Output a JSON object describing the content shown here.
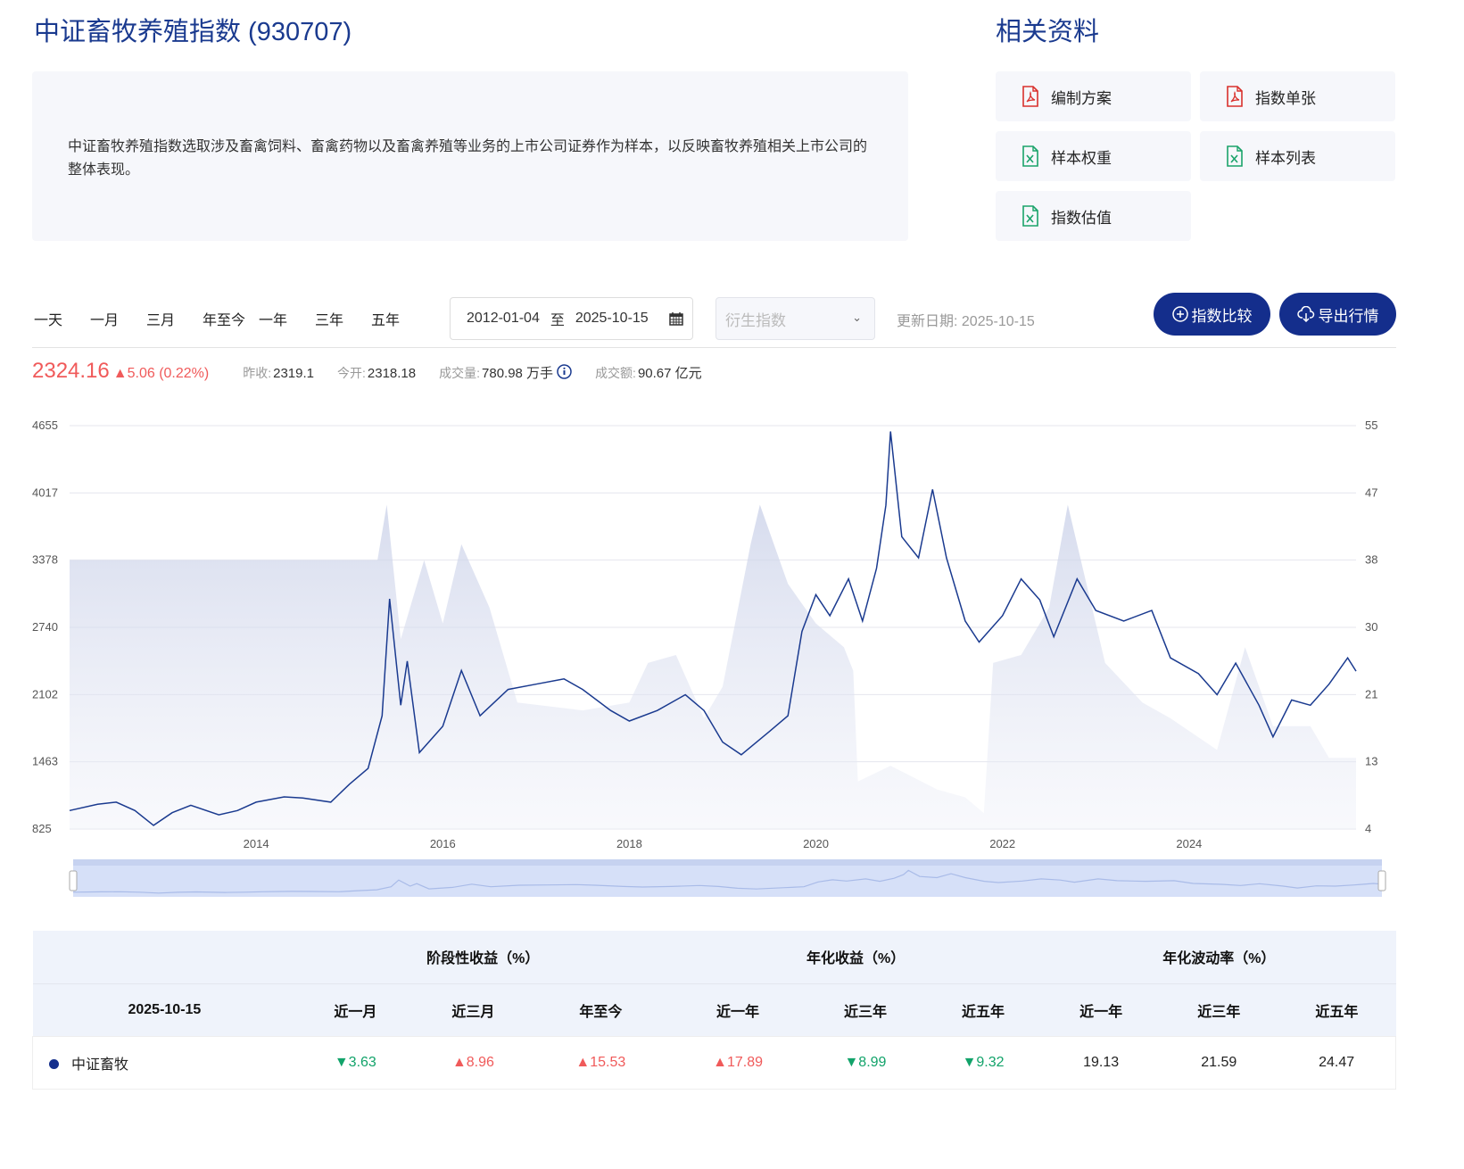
{
  "title": "中证畜牧养殖指数 (930707)",
  "description": "中证畜牧养殖指数选取涉及畜禽饲料、畜禽药物以及畜禽养殖等业务的上市公司证券作为样本，以反映畜牧养殖相关上市公司的整体表现。",
  "related": {
    "title": "相关资料",
    "docs": [
      {
        "label": "编制方案",
        "icon": "pdf-icon"
      },
      {
        "label": "指数单张",
        "icon": "pdf-icon"
      },
      {
        "label": "样本权重",
        "icon": "excel-icon"
      },
      {
        "label": "样本列表",
        "icon": "excel-icon"
      },
      {
        "label": "指数估值",
        "icon": "excel-icon"
      }
    ]
  },
  "toolbar": {
    "periods": [
      "一天",
      "一月",
      "三月",
      "年至今",
      "一年",
      "三年",
      "五年"
    ],
    "date_start": "2012-01-04",
    "date_sep": "至",
    "date_end": "2025-10-15",
    "derived_placeholder": "衍生指数",
    "update_date": "更新日期: 2025-10-15",
    "compare_label": "指数比较",
    "export_label": "导出行情"
  },
  "quote": {
    "price": "2324.16",
    "change": "▲5.06 (0.22%)",
    "prev_close_label": "昨收:",
    "prev_close": "2319.1",
    "open_label": "今开:",
    "open": "2318.18",
    "volume_label": "成交量:",
    "volume": "780.98 万手",
    "amount_label": "成交额:",
    "amount": "90.67 亿元"
  },
  "colors": {
    "brand": "#142e8c",
    "up": "#f05a5a",
    "down": "#12a36a",
    "line": "#1a3a8f"
  },
  "chart_data": {
    "type": "line",
    "left_ticks": [
      "4655",
      "4017",
      "3378",
      "2740",
      "2102",
      "1463",
      "825"
    ],
    "right_ticks": [
      "55",
      "47",
      "38",
      "30",
      "21",
      "13",
      "4"
    ],
    "x_ticks": [
      "2014",
      "2016",
      "2018",
      "2020",
      "2022",
      "2024"
    ],
    "ylim": [
      825,
      4655
    ],
    "y2lim": [
      4,
      55
    ],
    "xlim": [
      2012.0,
      2025.79
    ],
    "index_series": {
      "name": "中证畜牧",
      "points": [
        [
          2012.0,
          1000
        ],
        [
          2012.3,
          1060
        ],
        [
          2012.5,
          1080
        ],
        [
          2012.7,
          1000
        ],
        [
          2012.9,
          860
        ],
        [
          2013.1,
          980
        ],
        [
          2013.3,
          1050
        ],
        [
          2013.6,
          960
        ],
        [
          2013.8,
          1000
        ],
        [
          2014.0,
          1080
        ],
        [
          2014.3,
          1130
        ],
        [
          2014.5,
          1120
        ],
        [
          2014.8,
          1080
        ],
        [
          2015.0,
          1250
        ],
        [
          2015.2,
          1400
        ],
        [
          2015.35,
          1900
        ],
        [
          2015.43,
          3010
        ],
        [
          2015.55,
          2000
        ],
        [
          2015.62,
          2420
        ],
        [
          2015.75,
          1550
        ],
        [
          2016.0,
          1800
        ],
        [
          2016.2,
          2330
        ],
        [
          2016.4,
          1900
        ],
        [
          2016.7,
          2150
        ],
        [
          2017.0,
          2200
        ],
        [
          2017.3,
          2250
        ],
        [
          2017.5,
          2150
        ],
        [
          2017.8,
          1950
        ],
        [
          2018.0,
          1850
        ],
        [
          2018.3,
          1950
        ],
        [
          2018.6,
          2100
        ],
        [
          2018.8,
          1950
        ],
        [
          2019.0,
          1650
        ],
        [
          2019.2,
          1530
        ],
        [
          2019.5,
          1750
        ],
        [
          2019.7,
          1900
        ],
        [
          2019.85,
          2700
        ],
        [
          2020.0,
          3050
        ],
        [
          2020.15,
          2850
        ],
        [
          2020.35,
          3200
        ],
        [
          2020.5,
          2800
        ],
        [
          2020.65,
          3300
        ],
        [
          2020.75,
          3900
        ],
        [
          2020.8,
          4600
        ],
        [
          2020.92,
          3600
        ],
        [
          2021.1,
          3400
        ],
        [
          2021.25,
          4050
        ],
        [
          2021.4,
          3400
        ],
        [
          2021.6,
          2800
        ],
        [
          2021.75,
          2600
        ],
        [
          2022.0,
          2850
        ],
        [
          2022.2,
          3200
        ],
        [
          2022.4,
          3000
        ],
        [
          2022.55,
          2650
        ],
        [
          2022.8,
          3200
        ],
        [
          2023.0,
          2900
        ],
        [
          2023.3,
          2800
        ],
        [
          2023.6,
          2900
        ],
        [
          2023.8,
          2450
        ],
        [
          2024.1,
          2300
        ],
        [
          2024.3,
          2100
        ],
        [
          2024.5,
          2400
        ],
        [
          2024.75,
          2000
        ],
        [
          2024.9,
          1700
        ],
        [
          2025.1,
          2050
        ],
        [
          2025.3,
          2000
        ],
        [
          2025.5,
          2200
        ],
        [
          2025.7,
          2450
        ],
        [
          2025.79,
          2324
        ]
      ]
    },
    "area_series": {
      "points": [
        [
          2012.0,
          38
        ],
        [
          2015.3,
          38
        ],
        [
          2015.4,
          45
        ],
        [
          2015.55,
          28
        ],
        [
          2015.8,
          38
        ],
        [
          2016.0,
          30
        ],
        [
          2016.2,
          40
        ],
        [
          2016.5,
          32
        ],
        [
          2016.8,
          20
        ],
        [
          2017.5,
          19
        ],
        [
          2018.0,
          20
        ],
        [
          2018.2,
          25
        ],
        [
          2018.5,
          26
        ],
        [
          2018.8,
          18
        ],
        [
          2019.0,
          22
        ],
        [
          2019.3,
          40
        ],
        [
          2019.4,
          45
        ],
        [
          2019.7,
          35
        ],
        [
          2020.0,
          30
        ],
        [
          2020.3,
          27
        ],
        [
          2020.4,
          24
        ],
        [
          2020.45,
          10
        ],
        [
          2020.8,
          12
        ],
        [
          2021.3,
          9
        ],
        [
          2021.6,
          8
        ],
        [
          2021.8,
          6
        ],
        [
          2021.9,
          25
        ],
        [
          2022.2,
          26
        ],
        [
          2022.5,
          32
        ],
        [
          2022.7,
          45
        ],
        [
          2022.9,
          35
        ],
        [
          2023.1,
          25
        ],
        [
          2023.5,
          20
        ],
        [
          2023.8,
          18
        ],
        [
          2024.3,
          14
        ],
        [
          2024.6,
          27
        ],
        [
          2024.9,
          17
        ],
        [
          2025.3,
          17
        ],
        [
          2025.5,
          13
        ],
        [
          2025.79,
          13
        ]
      ]
    }
  },
  "table": {
    "groups": [
      "阶段性收益（%）",
      "年化收益（%）",
      "年化波动率（%）"
    ],
    "date": "2025-10-15",
    "columns": [
      "近一月",
      "近三月",
      "年至今",
      "近一年",
      "近三年",
      "近五年",
      "近一年",
      "近三年",
      "近五年"
    ],
    "row": {
      "name": "中证畜牧",
      "values": [
        {
          "v": "▼3.63",
          "d": "dn"
        },
        {
          "v": "▲8.96",
          "d": "up"
        },
        {
          "v": "▲15.53",
          "d": "up"
        },
        {
          "v": "▲17.89",
          "d": "up"
        },
        {
          "v": "▼8.99",
          "d": "dn"
        },
        {
          "v": "▼9.32",
          "d": "dn"
        },
        {
          "v": "19.13",
          "d": ""
        },
        {
          "v": "21.59",
          "d": ""
        },
        {
          "v": "24.47",
          "d": ""
        }
      ]
    }
  }
}
